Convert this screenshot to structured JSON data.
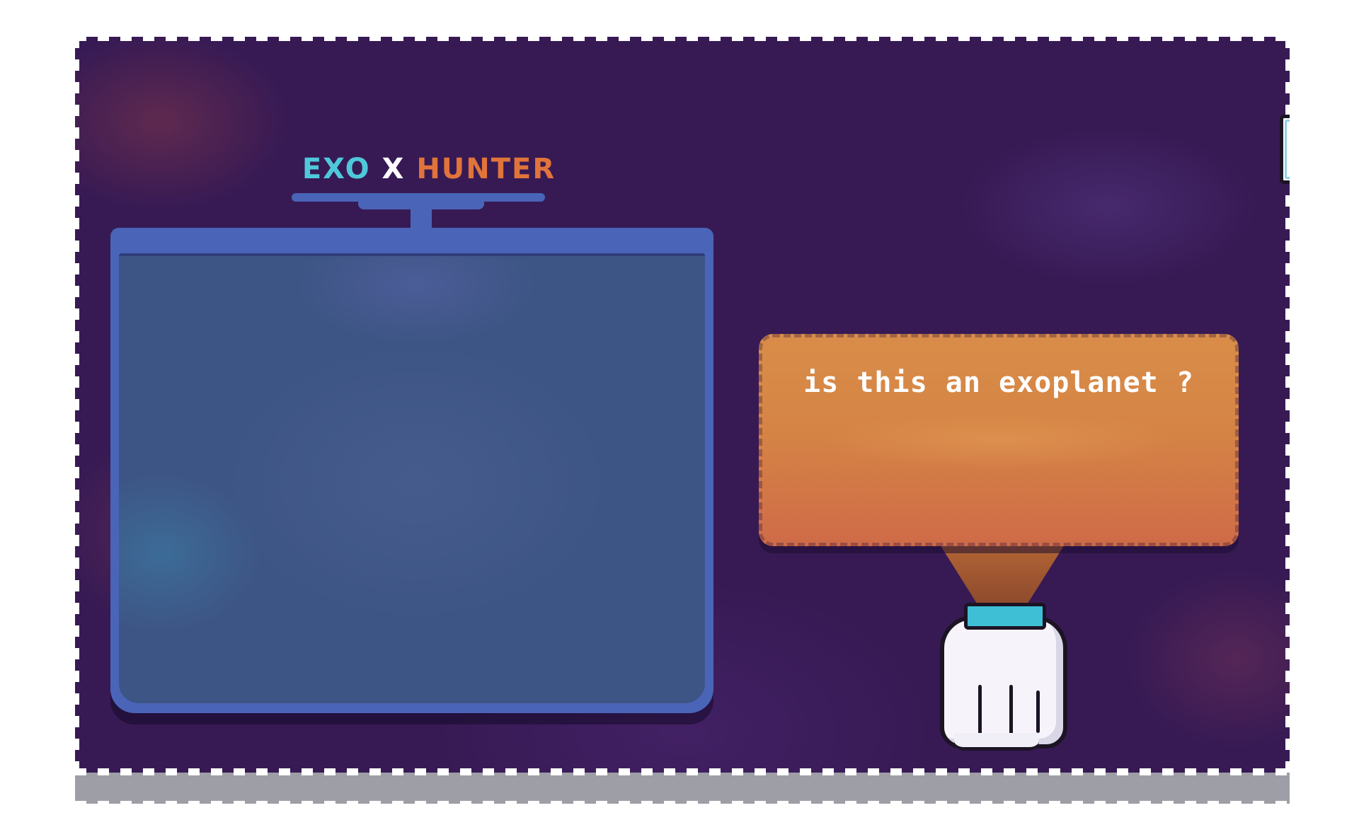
{
  "title": {
    "part1": "EXO",
    "part2": "X",
    "part3": "HUNTER"
  },
  "bubble": {
    "text": "is this an exoplanet ?"
  },
  "icons": {
    "id_card": "id-card-icon",
    "robot_hand": "robot-fist-icon"
  },
  "colors": {
    "board_bg": "#371a54",
    "screen_frame": "#4a64b8",
    "screen_fill": "#3d5585",
    "bubble_orange": "#d58445",
    "title_cyan": "#4fc8da",
    "title_orange": "#e0743a",
    "cuff_teal": "#3fbfd6"
  }
}
